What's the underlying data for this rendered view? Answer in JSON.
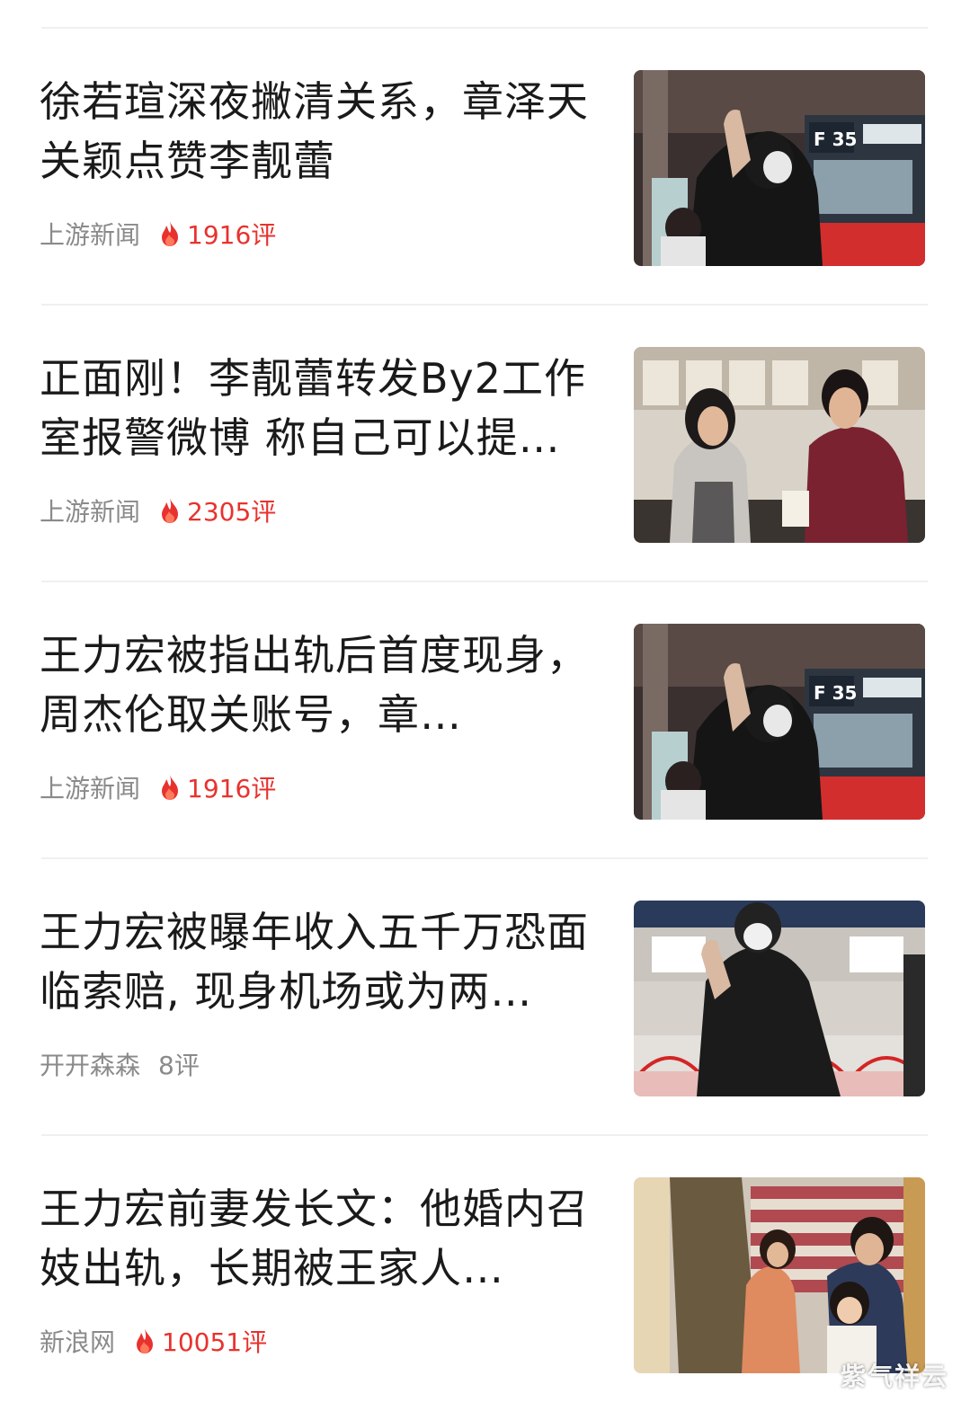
{
  "feed": {
    "items": [
      {
        "title": "徐若瑄深夜撇清关系，章泽天关颖点赞李靓蕾",
        "source": "上游新闻",
        "comments": "1916评",
        "hot": true,
        "image": "airport-wave-photo"
      },
      {
        "title": "正面刚！李靓蕾转发By2工作室报警微博 称自己可以提…",
        "source": "上游新闻",
        "comments": "2305评",
        "hot": true,
        "image": "couple-photo"
      },
      {
        "title": "王力宏被指出轨后首度现身，周杰伦取关账号，章…",
        "source": "上游新闻",
        "comments": "1916评",
        "hot": true,
        "image": "airport-wave-photo"
      },
      {
        "title": "王力宏被曝年收入五千万恐面临索赔, 现身机场或为两…",
        "source": "开开森森",
        "comments": "8评",
        "hot": false,
        "image": "airport-mask-photo"
      },
      {
        "title": "王力宏前妻发长文：他婚内召妓出轨，长期被王家人…",
        "source": "新浪网",
        "comments": "10051评",
        "hot": true,
        "image": "family-stairs-photo"
      }
    ]
  },
  "watermark": "紫气祥云",
  "colors": {
    "hot": "#e8322e",
    "meta": "#8a8a8a",
    "title": "#1a1a1a",
    "divider": "#f0f0f0"
  }
}
